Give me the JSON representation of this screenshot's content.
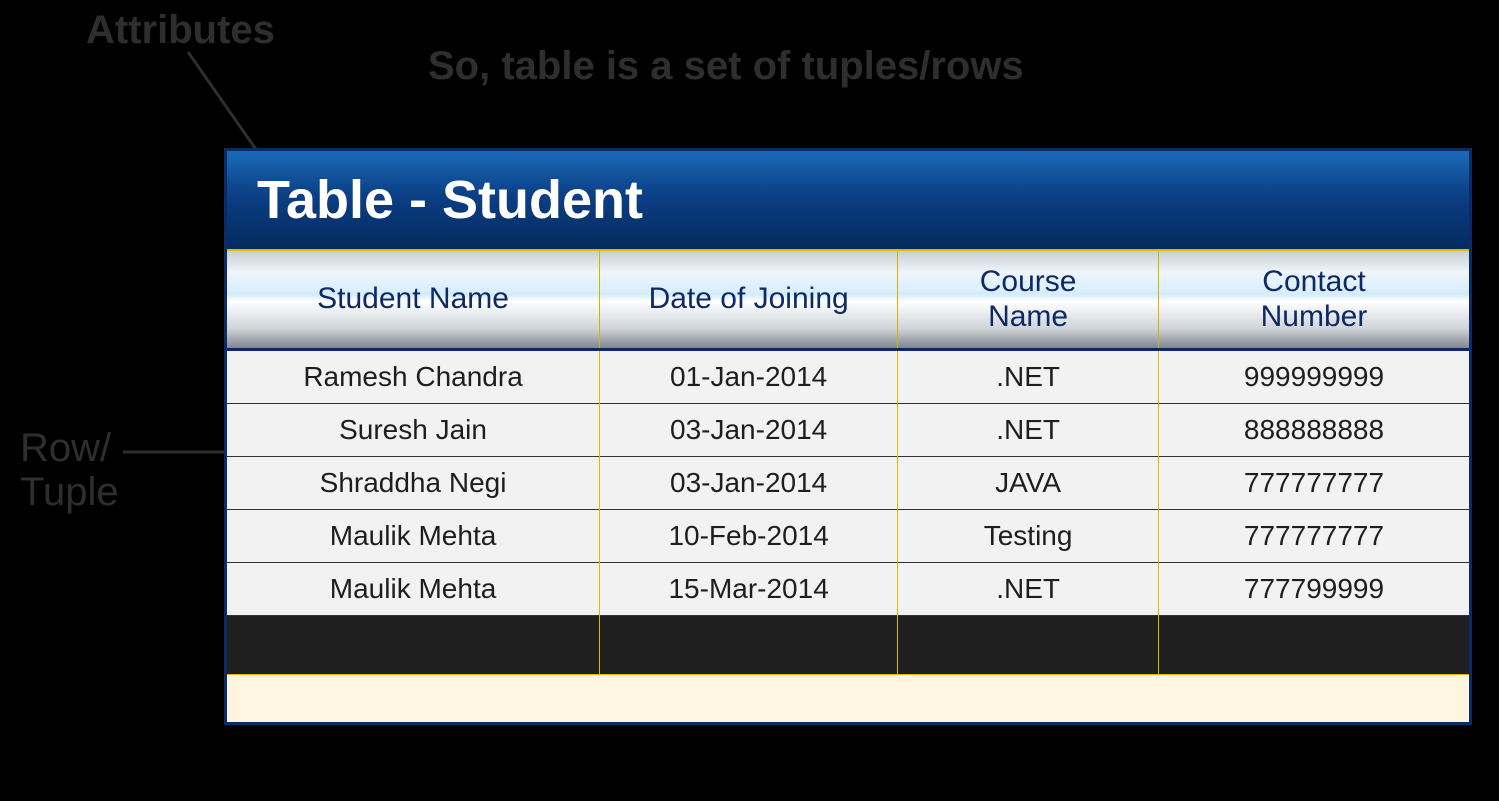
{
  "labels": {
    "attributes": "Attributes",
    "row_tuple_line1": "Row/",
    "row_tuple_line2": "Tuple"
  },
  "caption": "So, table is a set of tuples/rows",
  "table": {
    "title": "Table - Student",
    "columns": {
      "name": "Student Name",
      "date": "Date of Joining",
      "course_line1": "Course",
      "course_line2": "Name",
      "contact_line1": "Contact",
      "contact_line2": "Number"
    },
    "rows": [
      {
        "name": "Ramesh Chandra",
        "date": "01-Jan-2014",
        "course": ".NET",
        "contact": "999999999"
      },
      {
        "name": "Suresh Jain",
        "date": "03-Jan-2014",
        "course": ".NET",
        "contact": "888888888"
      },
      {
        "name": "Shraddha Negi",
        "date": "03-Jan-2014",
        "course": "JAVA",
        "contact": "777777777"
      },
      {
        "name": "Maulik Mehta",
        "date": "10-Feb-2014",
        "course": "Testing",
        "contact": "777777777"
      },
      {
        "name": "Maulik Mehta",
        "date": "15-Mar-2014",
        "course": ".NET",
        "contact": "777799999"
      }
    ]
  }
}
